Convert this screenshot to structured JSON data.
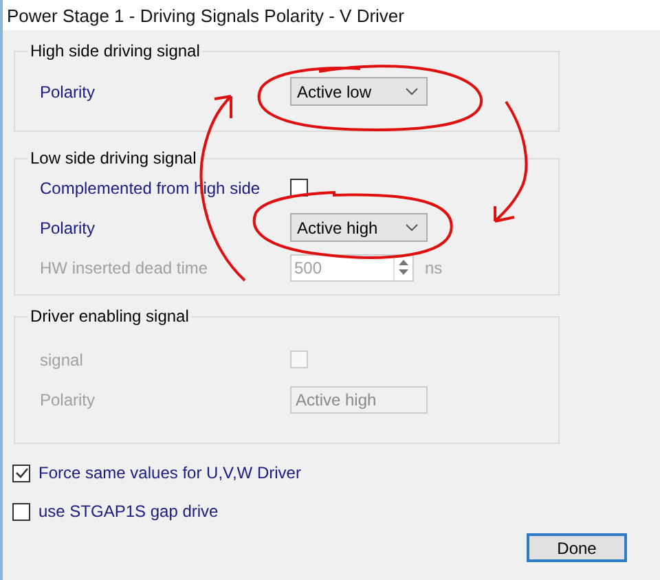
{
  "window": {
    "title": "Power Stage 1 - Driving Signals Polarity - V Driver"
  },
  "groups": [
    {
      "title": "High side driving signal",
      "rows": [
        {
          "kind": "combo",
          "label": "Polarity",
          "value": "Active low",
          "disabled": false
        }
      ]
    },
    {
      "title": "Low side driving signal",
      "rows": [
        {
          "kind": "check",
          "label": "Complemented from high side",
          "checked": false,
          "disabled": false
        },
        {
          "kind": "combo",
          "label": "Polarity",
          "value": "Active high",
          "disabled": false
        },
        {
          "kind": "spin",
          "label": "HW inserted dead time",
          "value": "500",
          "unit": "ns",
          "disabled": true
        }
      ]
    },
    {
      "title": "Driver enabling signal",
      "rows": [
        {
          "kind": "check",
          "label": "signal",
          "checked": false,
          "disabled": true
        },
        {
          "kind": "text",
          "label": "Polarity",
          "value": "Active high",
          "disabled": true
        }
      ]
    }
  ],
  "options": [
    {
      "label": "Force same values for U,V,W Driver",
      "checked": true
    },
    {
      "label": "use STGAP1S gap drive",
      "checked": false
    }
  ],
  "buttons": [
    {
      "label": "Done",
      "default": true
    }
  ]
}
